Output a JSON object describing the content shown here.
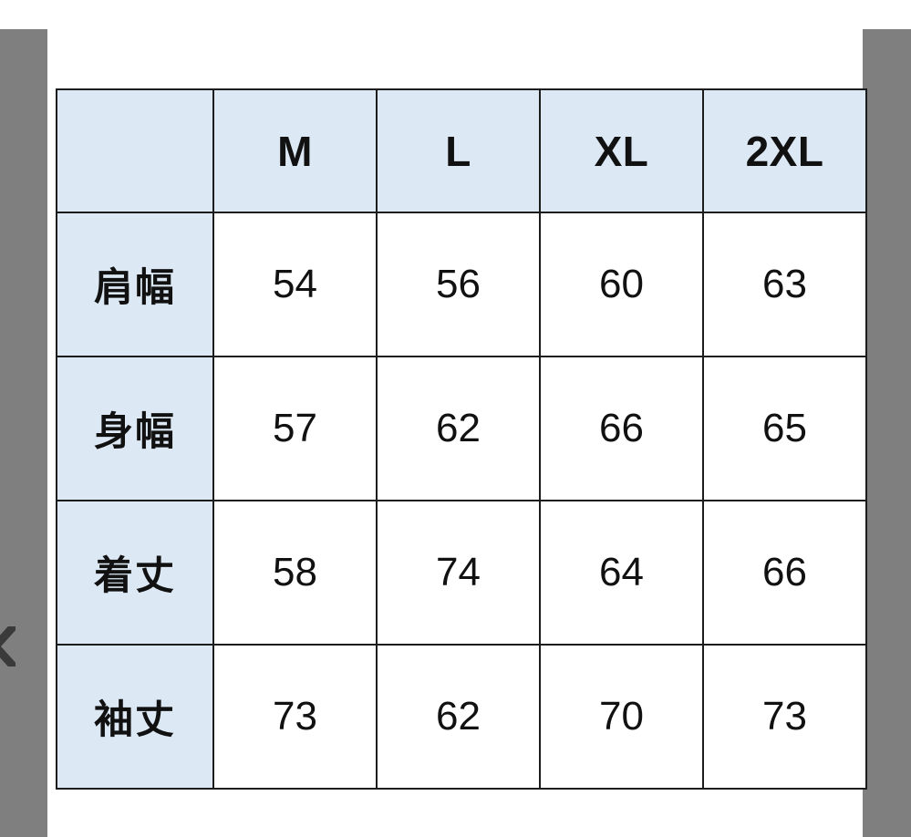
{
  "viewer": {
    "left_panel_label": "previous-image-panel",
    "right_panel_label": "next-image-panel",
    "prev_arrow_label": "‹"
  },
  "table": {
    "caption": "",
    "corner_label": "",
    "column_headers": [
      "",
      "M",
      "L",
      "XL",
      "2XL"
    ],
    "rows": [
      {
        "label": "肩幅",
        "values": [
          "54",
          "56",
          "60",
          "63"
        ]
      },
      {
        "label": "身幅",
        "values": [
          "57",
          "62",
          "66",
          "65"
        ]
      },
      {
        "label": "着丈",
        "values": [
          "58",
          "74",
          "64",
          "66"
        ]
      },
      {
        "label": "袖丈",
        "values": [
          "73",
          "62",
          "70",
          "73"
        ]
      }
    ]
  },
  "colors": {
    "header_fill": "#dce8f4",
    "cell_fill": "#ffffff",
    "border": "#1c1c1c",
    "panel_gray": "#7f7f7f",
    "text": "#111111"
  }
}
